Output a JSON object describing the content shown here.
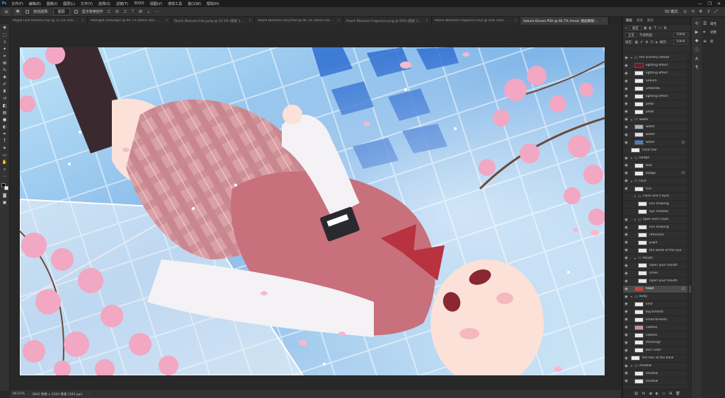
{
  "app": {
    "logo": "Ps",
    "window_controls": [
      "—",
      "❐",
      "✕"
    ]
  },
  "menubar": {
    "items": [
      "文件(F)",
      "编辑(E)",
      "图像(I)",
      "图层(L)",
      "文字(Y)",
      "选择(S)",
      "滤镜(T)",
      "3D(D)",
      "视图(V)",
      "增效工具",
      "窗口(W)",
      "帮助(H)"
    ]
  },
  "optionsbar": {
    "auto_select_label": "自动选择:",
    "auto_select_value": "图层",
    "show_transform_label": "显示变换控件",
    "mode_3d_label": "3D 模式:"
  },
  "tabs": [
    {
      "label": "Maple Leaf Kimono.PSD @ 72.3% (Hair, RGB/...",
      "active": false
    },
    {
      "label": "Midnight Schoolgirl @ 66.7% (Black Hair, RGB/...",
      "active": false
    },
    {
      "label": "Peach Blossom Fairy.png @ 33.3% (图层 1, RGB/...",
      "active": false
    },
    {
      "label": "Peach Blossom Fairy.PSD @ 66.7% (Black Hair, RGB/...",
      "active": false
    },
    {
      "label": "Peach Blossom Fragrance.png @ 50% (图层 1, RGB/...",
      "active": false
    },
    {
      "label": "Peach Blossom Fragrance.PSD @ 50% (Hair Shado...",
      "active": false
    },
    {
      "label": "Sakura Dream.PSD @ 66.7% (head, 图层蒙版/8) *",
      "active": true
    }
  ],
  "statusbar": {
    "zoom": "66.67%",
    "doc_info": "3840 像素 x 2160 像素 (300 ppi)"
  },
  "layers_panel": {
    "tabs": [
      {
        "label": "图层",
        "active": true
      },
      {
        "label": "通道",
        "active": false
      },
      {
        "label": "路径",
        "active": false
      }
    ],
    "kind_filter": "类型",
    "blend_mode": "正常",
    "opacity_label": "不透明度:",
    "opacity_value": "100%",
    "lock_label": "锁定:",
    "fill_label": "填充:",
    "fill_value": "100%",
    "layers": [
      {
        "name": "the scenery ahead",
        "type": "group",
        "depth": 0,
        "visible": true,
        "open": true,
        "selected": false,
        "locked": false
      },
      {
        "name": "lighting effect",
        "type": "layer",
        "depth": 1,
        "visible": true,
        "open": false,
        "selected": false,
        "locked": false,
        "thumb": "#6d1f24"
      },
      {
        "name": "lighting effect",
        "type": "layer",
        "depth": 1,
        "visible": true,
        "open": false,
        "selected": false,
        "locked": false,
        "thumb": "#e9e9e9"
      },
      {
        "name": "Sakura",
        "type": "layer",
        "depth": 1,
        "visible": true,
        "open": false,
        "selected": false,
        "locked": false,
        "thumb": "#e9e9e9"
      },
      {
        "name": "umbrella",
        "type": "layer",
        "depth": 1,
        "visible": true,
        "open": false,
        "selected": false,
        "locked": false,
        "thumb": "#e9e9e9"
      },
      {
        "name": "lighting effect",
        "type": "layer",
        "depth": 1,
        "visible": true,
        "open": false,
        "selected": false,
        "locked": false,
        "thumb": "#e9e9e9"
      },
      {
        "name": "petal",
        "type": "layer",
        "depth": 1,
        "visible": true,
        "open": false,
        "selected": false,
        "locked": false,
        "thumb": "#e9e9e9"
      },
      {
        "name": "petal",
        "type": "layer",
        "depth": 1,
        "visible": true,
        "open": false,
        "selected": false,
        "locked": false,
        "thumb": "#e9e9e9"
      },
      {
        "name": "water",
        "type": "group",
        "depth": 0,
        "visible": true,
        "open": true,
        "selected": false,
        "locked": false
      },
      {
        "name": "water",
        "type": "layer",
        "depth": 1,
        "visible": true,
        "open": false,
        "selected": false,
        "locked": false,
        "thumb": "#9fb7c9"
      },
      {
        "name": "water",
        "type": "layer",
        "depth": 1,
        "visible": true,
        "open": false,
        "selected": false,
        "locked": false,
        "thumb": "#d5dde3"
      },
      {
        "name": "water",
        "type": "layer",
        "depth": 1,
        "visible": true,
        "open": false,
        "selected": false,
        "locked": true,
        "thumb": "#4a7bd0"
      },
      {
        "name": "front hair",
        "type": "layer",
        "depth": 0,
        "visible": false,
        "open": false,
        "selected": false,
        "locked": false,
        "thumb": "#e9e9e9"
      },
      {
        "name": "badge",
        "type": "group",
        "depth": 0,
        "visible": true,
        "open": true,
        "selected": false,
        "locked": false
      },
      {
        "name": "text",
        "type": "layer",
        "depth": 1,
        "visible": true,
        "open": false,
        "selected": false,
        "locked": false,
        "thumb": "#e9e9e9"
      },
      {
        "name": "badge",
        "type": "layer",
        "depth": 1,
        "visible": true,
        "open": false,
        "selected": false,
        "locked": true,
        "thumb": "#e9e9e9"
      },
      {
        "name": "face",
        "type": "group",
        "depth": 0,
        "visible": true,
        "open": true,
        "selected": false,
        "locked": false
      },
      {
        "name": "hue",
        "type": "layer",
        "depth": 1,
        "visible": true,
        "open": false,
        "selected": false,
        "locked": false,
        "thumb": "#e9e9e9"
      },
      {
        "name": "close one's eyes",
        "type": "group",
        "depth": 1,
        "visible": false,
        "open": true,
        "selected": false,
        "locked": false
      },
      {
        "name": "line drawing",
        "type": "layer",
        "depth": 2,
        "visible": false,
        "open": false,
        "selected": false,
        "locked": false,
        "thumb": "#e9e9e9"
      },
      {
        "name": "eye shadow",
        "type": "layer",
        "depth": 2,
        "visible": false,
        "open": false,
        "selected": false,
        "locked": false,
        "thumb": "#e9e9e9"
      },
      {
        "name": "open one's eyes",
        "type": "group",
        "depth": 1,
        "visible": true,
        "open": true,
        "selected": false,
        "locked": false
      },
      {
        "name": "line drawing",
        "type": "layer",
        "depth": 2,
        "visible": true,
        "open": false,
        "selected": false,
        "locked": false,
        "thumb": "#e9e9e9"
      },
      {
        "name": "reflection",
        "type": "layer",
        "depth": 2,
        "visible": true,
        "open": false,
        "selected": false,
        "locked": false,
        "thumb": "#e9e9e9"
      },
      {
        "name": "pupil",
        "type": "layer",
        "depth": 2,
        "visible": true,
        "open": false,
        "selected": false,
        "locked": false,
        "thumb": "#e9e9e9"
      },
      {
        "name": "the white of the eye",
        "type": "layer",
        "depth": 2,
        "visible": true,
        "open": false,
        "selected": false,
        "locked": false,
        "thumb": "#e9e9e9"
      },
      {
        "name": "Mouth",
        "type": "group",
        "depth": 1,
        "visible": true,
        "open": true,
        "selected": false,
        "locked": false
      },
      {
        "name": "Open your mouth",
        "type": "layer",
        "depth": 2,
        "visible": true,
        "open": false,
        "selected": false,
        "locked": false,
        "thumb": "#e9e9e9"
      },
      {
        "name": "smile",
        "type": "layer",
        "depth": 2,
        "visible": true,
        "open": false,
        "selected": false,
        "locked": false,
        "thumb": "#e9e9e9"
      },
      {
        "name": "Open your mouth",
        "type": "layer",
        "depth": 2,
        "visible": true,
        "open": false,
        "selected": false,
        "locked": false,
        "thumb": "#e9e9e9"
      },
      {
        "name": "head",
        "type": "layer",
        "depth": 1,
        "visible": true,
        "open": false,
        "selected": true,
        "locked": true,
        "thumb": "#d04040"
      },
      {
        "name": "body",
        "type": "group",
        "depth": 0,
        "visible": true,
        "open": true,
        "selected": false,
        "locked": false
      },
      {
        "name": "lime",
        "type": "layer",
        "depth": 1,
        "visible": true,
        "open": false,
        "selected": false,
        "locked": false,
        "thumb": "#e9e9e9"
      },
      {
        "name": "big breasts",
        "type": "layer",
        "depth": 1,
        "visible": true,
        "open": false,
        "selected": false,
        "locked": false,
        "thumb": "#e9e9e9"
      },
      {
        "name": "small breasts",
        "type": "layer",
        "depth": 1,
        "visible": true,
        "open": false,
        "selected": false,
        "locked": false,
        "thumb": "#e9e9e9"
      },
      {
        "name": "clothes",
        "type": "layer",
        "depth": 1,
        "visible": true,
        "open": false,
        "selected": false,
        "locked": false,
        "thumb": "#d09090"
      },
      {
        "name": "clothes",
        "type": "layer",
        "depth": 1,
        "visible": true,
        "open": false,
        "selected": false,
        "locked": false,
        "thumb": "#e9e9e9"
      },
      {
        "name": "stockings",
        "type": "layer",
        "depth": 1,
        "visible": true,
        "open": false,
        "selected": false,
        "locked": false,
        "thumb": "#e9e9e9"
      },
      {
        "name": "skin color",
        "type": "layer",
        "depth": 1,
        "visible": true,
        "open": false,
        "selected": false,
        "locked": false,
        "thumb": "#e9e9e9"
      },
      {
        "name": "the hair at the back",
        "type": "layer",
        "depth": 0,
        "visible": true,
        "open": false,
        "selected": false,
        "locked": false,
        "thumb": "#e9e9e9"
      },
      {
        "name": "shadow",
        "type": "group",
        "depth": 0,
        "visible": true,
        "open": true,
        "selected": false,
        "locked": false
      },
      {
        "name": "shadow",
        "type": "layer",
        "depth": 1,
        "visible": true,
        "open": false,
        "selected": false,
        "locked": false,
        "thumb": "#e9e9e9"
      },
      {
        "name": "shadow",
        "type": "layer",
        "depth": 1,
        "visible": true,
        "open": false,
        "selected": false,
        "locked": false,
        "thumb": "#e9e9e9"
      }
    ]
  },
  "side_panels": [
    {
      "icon": "☰",
      "label": "属性"
    },
    {
      "icon": "⌗",
      "label": "调整"
    },
    {
      "icon": "≡",
      "label": "库"
    }
  ],
  "colors": {
    "accent": "#31a8ff",
    "panel": "#2f2f2f",
    "selected_row": "#4b4b4b",
    "water_blue": "#4a7bd0",
    "sakura_pink": "#f2a7c3",
    "vest_pink": "#c8707b"
  }
}
